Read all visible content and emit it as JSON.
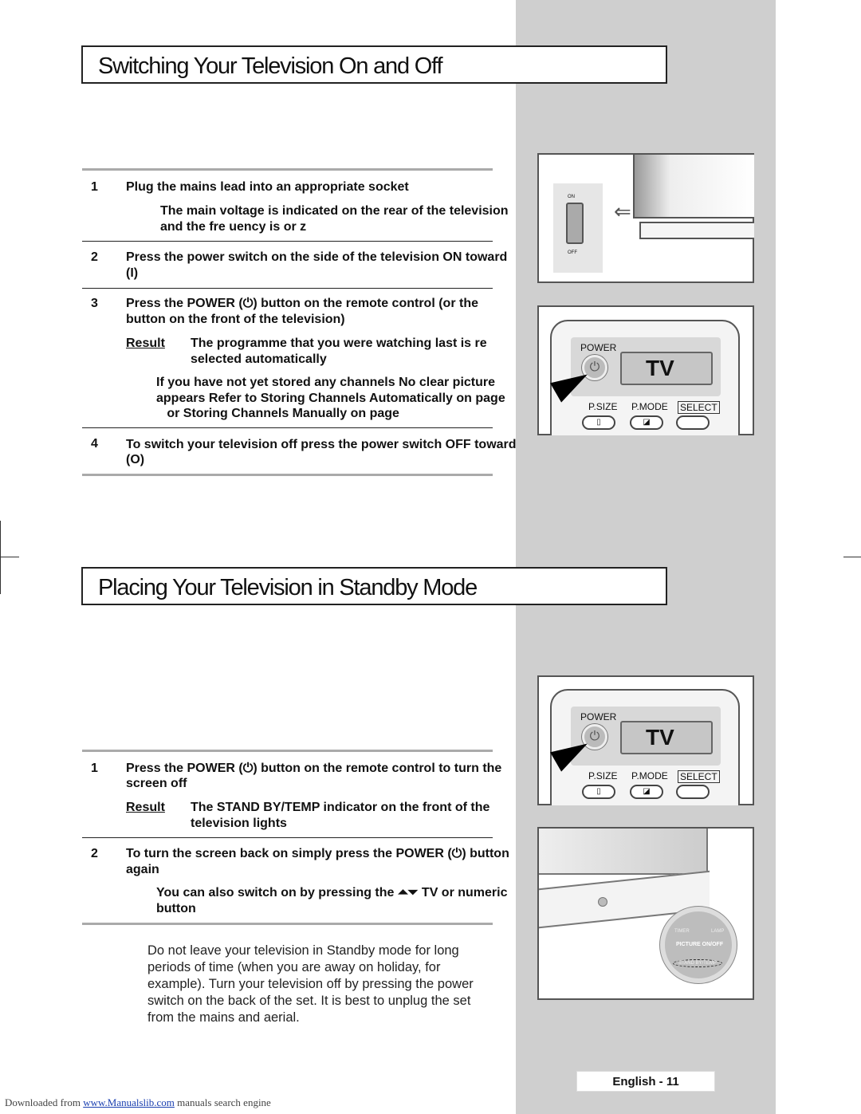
{
  "section1": {
    "title": "Switching Your Television On and Off",
    "steps": [
      {
        "num": "1",
        "text": "Plug the mains lead into an appropriate socket",
        "note_lines": [
          "The main voltage is indicated on the rear of the television",
          "and the fre  uency is      or       z"
        ]
      },
      {
        "num": "2",
        "lines": [
          "Press the power switch on the side of the television ON toward",
          "(I)"
        ]
      },
      {
        "num": "3",
        "lines": [
          "Press the POWER (⏻) button on the remote control (or the",
          "button on the front of the television)"
        ],
        "result_label": "Result",
        "result_lines": [
          "The programme that you were watching last is re",
          "selected automatically"
        ],
        "note_lines": [
          "If you have not yet stored any channels  No clear picture",
          "appears  Refer to Storing Channels Automatically on page",
          "   or Storing Channels Manually on page"
        ]
      },
      {
        "num": "4",
        "lines": [
          "To switch your television off  press the power switch OFF toward",
          "(O)"
        ]
      }
    ]
  },
  "section2": {
    "title": "Placing Your Television in Standby Mode",
    "steps": [
      {
        "num": "1",
        "lines": [
          "Press the POWER (⏻) button on the remote control to turn the",
          "screen off"
        ],
        "result_label": "Result",
        "result_lines": [
          "The STAND BY/TEMP indicator on the front of the",
          "television lights"
        ]
      },
      {
        "num": "2",
        "lines": [
          "To turn the screen back on  simply press the POWER (⏻) button",
          "again"
        ],
        "note_lines": [
          "You can also switch on by pressing the ⏶⏷ TV or numeric",
          "button"
        ]
      }
    ],
    "note": "Do not leave your television in Standby mode for long periods of time (when you are away on holiday, for example). Turn your television off by pressing the power switch on the back of the set. It is best to unplug the set from the mains and aerial."
  },
  "remote": {
    "power_label": "POWER",
    "display": "TV",
    "psize": "P.SIZE",
    "pmode": "P.MODE",
    "select": "SELECT"
  },
  "tv_front": {
    "timer": "TIMER",
    "lamp": "LAMP",
    "picture": "PICTURE ON/OFF",
    "standby": "STAND BY/TEMP"
  },
  "switch": {
    "on": "ON",
    "off": "OFF"
  },
  "page_label": "English - 11",
  "footer": {
    "prefix": "Downloaded from ",
    "link": "www.Manualslib.com",
    "suffix": " manuals search engine"
  },
  "colors": {
    "sidebar": "#cfcfcf",
    "rule": "#aaaaaa",
    "link": "#1a3fb0"
  }
}
